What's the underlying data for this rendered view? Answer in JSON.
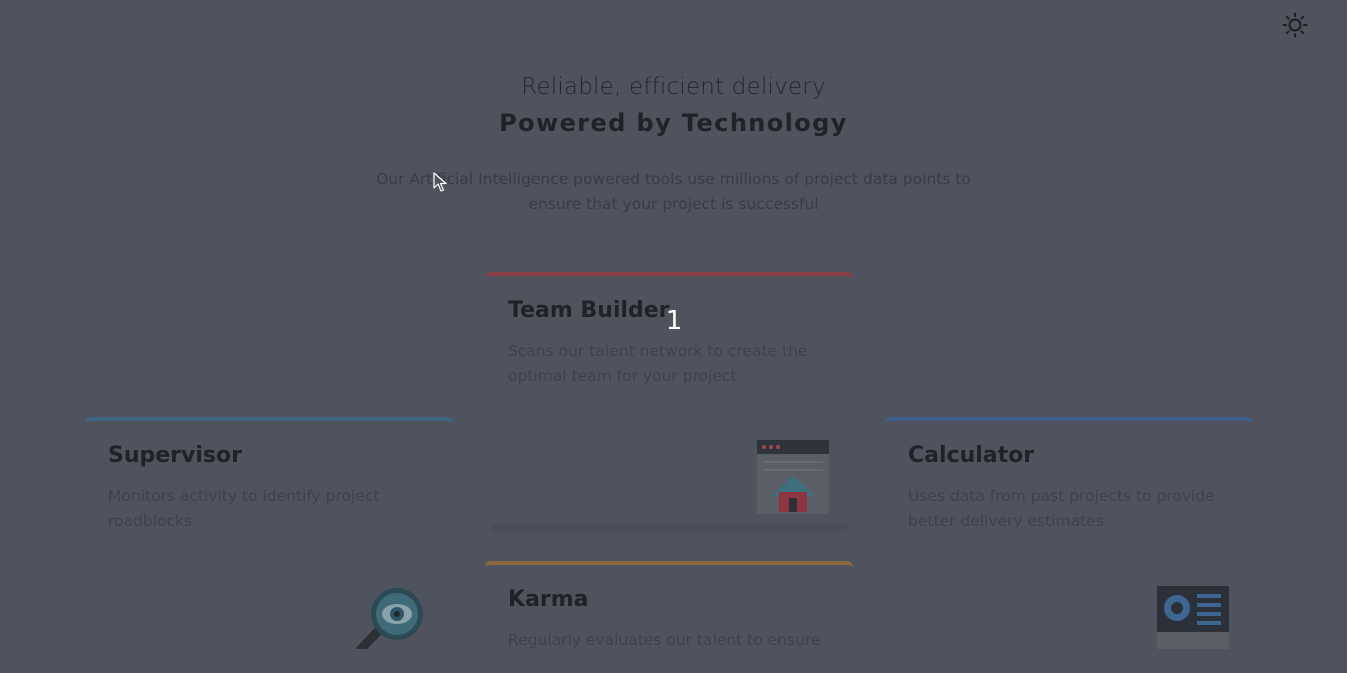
{
  "hero": {
    "kicker": "Reliable, efficient delivery",
    "title": "Powered by Technology",
    "description": "Our Artificial Intelligence powered tools use millions of project data points to ensure that your project is successful"
  },
  "slide_number": "1",
  "cards": [
    {
      "title": "Team Builder",
      "description": "Scans our talent network to create the optimal team for your project",
      "accent": "#8a3f45",
      "icon": "team-builder-illustration"
    },
    {
      "title": "Supervisor",
      "description": "Monitors activity to identify project roadblocks",
      "accent": "#3d6680",
      "icon": "magnifier-eye-illustration"
    },
    {
      "title": "Calculator",
      "description": "Uses data from past projects to provide better delivery estimates",
      "accent": "#3f5e8c",
      "icon": "calculator-illustration"
    },
    {
      "title": "Karma",
      "description": "Regularly evaluates our talent to ensure",
      "accent": "#8a6a3c",
      "icon": ""
    }
  ],
  "theme_toggle": {
    "icon": "sun-icon"
  },
  "colors": {
    "overlay_background": "#4f535d",
    "heading": "#1f2227",
    "body_text": "#3e4249"
  }
}
